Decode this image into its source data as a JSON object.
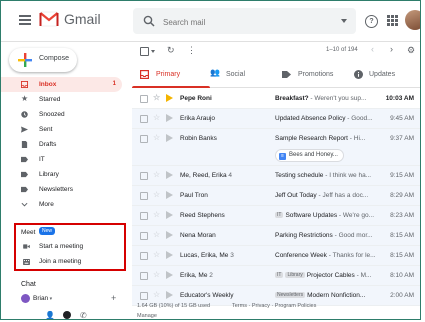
{
  "app": {
    "title": "Gmail"
  },
  "search": {
    "placeholder": "Search mail"
  },
  "compose": {
    "label": "Compose"
  },
  "sidebar": {
    "items": [
      {
        "label": "Inbox",
        "count": "1",
        "icon": "inbox-icon",
        "active": true
      },
      {
        "label": "Starred",
        "icon": "star-icon"
      },
      {
        "label": "Snoozed",
        "icon": "clock-icon"
      },
      {
        "label": "Sent",
        "icon": "send-icon"
      },
      {
        "label": "Drafts",
        "icon": "draft-icon"
      },
      {
        "label": "IT",
        "icon": "label-icon"
      },
      {
        "label": "Library",
        "icon": "label-icon"
      },
      {
        "label": "Newsletters",
        "icon": "label-icon"
      },
      {
        "label": "More",
        "icon": "chevron-down-icon"
      }
    ]
  },
  "meet": {
    "title": "Meet",
    "badge": "New",
    "start": "Start a meeting",
    "join": "Join a meeting"
  },
  "chat": {
    "title": "Chat",
    "user": "Brian",
    "add": "+"
  },
  "toolbar": {
    "count": "1–10 of 194"
  },
  "tabs": [
    {
      "label": "Primary",
      "icon": "inbox-icon"
    },
    {
      "label": "Social",
      "icon": "people-icon"
    },
    {
      "label": "Promotions",
      "icon": "tag-icon"
    },
    {
      "label": "Updates",
      "icon": "info-icon"
    }
  ],
  "emails": [
    {
      "sender": "Pepe Roni",
      "count": "",
      "labels": [],
      "subject": "Breakfast?",
      "snippet": " - Weren't you sup...",
      "time": "10:03 AM",
      "unread": true,
      "important": true
    },
    {
      "sender": "Erika Araujo",
      "count": "",
      "labels": [],
      "subject": "Updated Absence Policy",
      "snippet": " - Good...",
      "time": "9:45 AM",
      "unread": false,
      "important": false
    },
    {
      "sender": "Robin Banks",
      "count": "",
      "labels": [],
      "subject": "Sample Research Report",
      "snippet": " - Hi...",
      "time": "9:37 AM",
      "unread": false,
      "important": false,
      "attachment": "Bees and Honey..."
    },
    {
      "sender": "Me, Reed, Erika",
      "count": "4",
      "labels": [],
      "subject": "Testing schedule",
      "snippet": " - I think we ha...",
      "time": "9:15 AM",
      "unread": false,
      "important": false
    },
    {
      "sender": "Paul Tron",
      "count": "",
      "labels": [],
      "subject": "Jeff Out Today",
      "snippet": " - Jeff has a doc...",
      "time": "8:29 AM",
      "unread": false,
      "important": false
    },
    {
      "sender": "Reed Stephens",
      "count": "",
      "labels": [
        "IT"
      ],
      "subject": "Software Updates",
      "snippet": " - We're go...",
      "time": "8:23 AM",
      "unread": false,
      "important": false
    },
    {
      "sender": "Nena Moran",
      "count": "",
      "labels": [],
      "subject": "Parking Restrictions",
      "snippet": " - Good mor...",
      "time": "8:15 AM",
      "unread": false,
      "important": false
    },
    {
      "sender": "Lucas, Erika, Me",
      "count": "3",
      "labels": [],
      "subject": "Conference Week",
      "snippet": " - Thanks for le...",
      "time": "8:15 AM",
      "unread": false,
      "important": false
    },
    {
      "sender": "Erika, Me",
      "count": "2",
      "labels": [
        "IT",
        "Library"
      ],
      "subject": "Projector Cables",
      "snippet": " - M...",
      "time": "8:10 AM",
      "unread": false,
      "important": false
    },
    {
      "sender": "Educator's Weekly",
      "count": "",
      "labels": [
        "Newsletters"
      ],
      "subject": "Modern Nonfiction...",
      "snippet": "",
      "time": "2:00 AM",
      "unread": false,
      "important": false
    }
  ],
  "footer": {
    "storage": "1.64 GB (10%) of 15 GB used",
    "manage": "Manage",
    "terms": "Terms · Privacy · Program Policies"
  },
  "colors": {
    "accent": "#d93025",
    "highlight": "#d50000",
    "badge": "#1a73e8"
  }
}
